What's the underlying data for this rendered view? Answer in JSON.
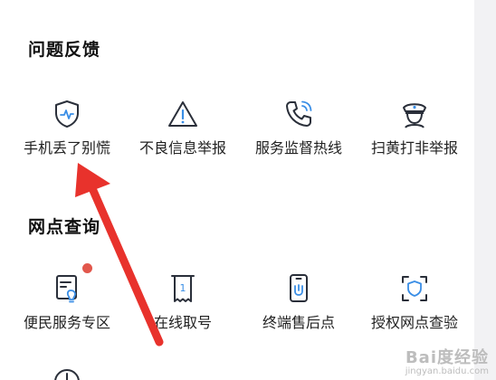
{
  "sections": [
    {
      "title": "问题反馈",
      "items": [
        {
          "label": "手机丢了别慌",
          "icon": "shield-pulse-icon"
        },
        {
          "label": "不良信息举报",
          "icon": "warning-triangle-icon"
        },
        {
          "label": "服务监督热线",
          "icon": "phone-call-icon"
        },
        {
          "label": "扫黄打非举报",
          "icon": "police-officer-icon"
        }
      ]
    },
    {
      "title": "网点查询",
      "items": [
        {
          "label": "便民服务专区",
          "icon": "service-card-icon",
          "badge": true
        },
        {
          "label": "在线取号",
          "icon": "queue-ticket-icon",
          "ticket_number": "1"
        },
        {
          "label": "终端售后点",
          "icon": "phone-repair-icon"
        },
        {
          "label": "授权网点查验",
          "icon": "scan-shield-icon"
        }
      ]
    }
  ],
  "colors": {
    "icon_stroke": "#2a2f3a",
    "icon_accent": "#3a8ee6",
    "badge": "#e2574c",
    "annotation_arrow": "#e8322c"
  },
  "watermark": {
    "main": "Bai度经验",
    "sub": "jingyan.baidu.com"
  }
}
